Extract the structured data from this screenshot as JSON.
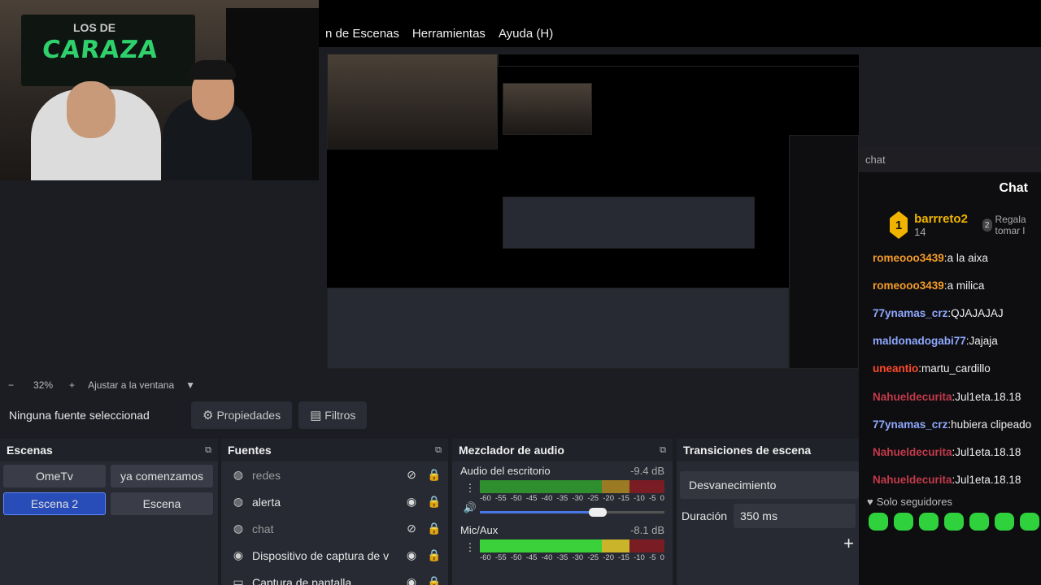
{
  "menu": {
    "items": [
      "n de Escenas",
      "Herramientas",
      "Ayuda (H)"
    ]
  },
  "webcam": {
    "banner_top": "LOS DE",
    "banner_main": "CARAZA"
  },
  "zoom": {
    "minus": "−",
    "level": "32%",
    "plus": "+",
    "fit": "Ajustar a la ventana",
    "caret": "▼"
  },
  "source_toolbar": {
    "no_source": "Ninguna fuente seleccionad",
    "properties": "Propiedades",
    "filters": "Filtros"
  },
  "scenes": {
    "title": "Escenas",
    "items": [
      {
        "label": "OmeTv",
        "active": false
      },
      {
        "label": "ya comenzamos",
        "active": false
      },
      {
        "label": "Escena 2",
        "active": true
      },
      {
        "label": "Escena",
        "active": false
      }
    ]
  },
  "sources": {
    "title": "Fuentes",
    "items": [
      {
        "label": "redes",
        "icon": "globe-icon",
        "visible": false
      },
      {
        "label": "alerta",
        "icon": "globe-icon",
        "visible": true
      },
      {
        "label": "chat",
        "icon": "globe-icon",
        "visible": false
      },
      {
        "label": "Dispositivo de captura de v",
        "icon": "camera-icon",
        "visible": true
      },
      {
        "label": "Captura de pantalla",
        "icon": "monitor-icon",
        "visible": true
      }
    ]
  },
  "mixer": {
    "title": "Mezclador de audio",
    "channels": [
      {
        "name": "Audio del escritorio",
        "db": "-9.4 dB"
      },
      {
        "name": "Mic/Aux",
        "db": "-8.1 dB"
      }
    ],
    "scale": [
      "-60",
      "-55",
      "-50",
      "-45",
      "-40",
      "-35",
      "-30",
      "-25",
      "-20",
      "-15",
      "-10",
      "-5",
      "0"
    ]
  },
  "transitions": {
    "title": "Transiciones de escena",
    "type": "Desvanecimiento",
    "duration_label": "Duración",
    "duration_value": "350 ms"
  },
  "chat": {
    "tab": "chat",
    "title": "Chat",
    "gift": {
      "rank": "1",
      "user": "barrreto2",
      "count": "14",
      "note": "Regala tomar l"
    },
    "messages": [
      {
        "user": "romeooo3439",
        "color": "#f49c2a",
        "text": "a la aixa"
      },
      {
        "user": "romeooo3439",
        "color": "#f49c2a",
        "text": "a milica"
      },
      {
        "user": "77ynamas_crz",
        "color": "#8fa8ff",
        "text": "QJAJAJAJ"
      },
      {
        "user": "maldonadogabi77",
        "color": "#8fa8ff",
        "text": "Jajaja"
      },
      {
        "user": "uneantio",
        "color": "#ff4a2a",
        "text": "martu_cardillo"
      },
      {
        "user": "Nahueldecurita",
        "color": "#c23a4a",
        "text": "Jul1eta.18.18"
      },
      {
        "user": "77ynamas_crz",
        "color": "#8fa8ff",
        "text": "hubiera clipeado"
      },
      {
        "user": "Nahueldecurita",
        "color": "#c23a4a",
        "text": "Jul1eta.18.18"
      },
      {
        "user": "Nahueldecurita",
        "color": "#c23a4a",
        "text": "Jul1eta.18.18"
      }
    ],
    "followers_only": "Solo seguidores"
  }
}
